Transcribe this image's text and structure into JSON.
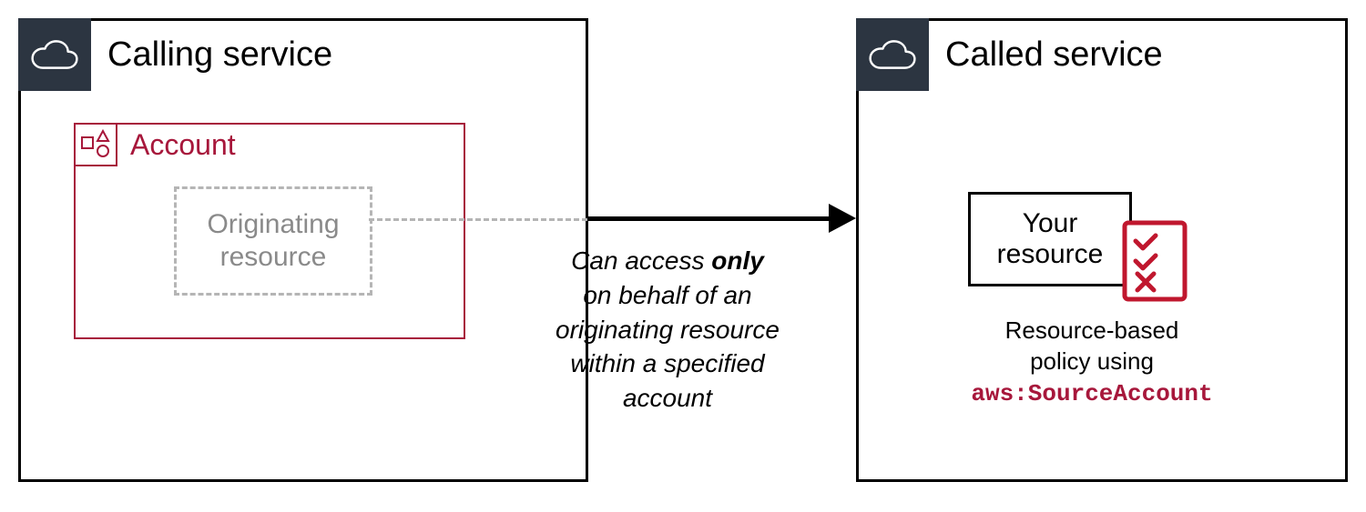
{
  "calling_service": {
    "title": "Calling service",
    "account": {
      "title": "Account",
      "originating_resource_label": "Originating\nresource"
    }
  },
  "arrow_caption": {
    "prefix": "Can access ",
    "bold": "only",
    "rest": "\non behalf of an\noriginating resource\nwithin a specified\naccount"
  },
  "called_service": {
    "title": "Called service",
    "your_resource_label": "Your\nresource",
    "policy_text": {
      "line1": "Resource-based",
      "line2": "policy using",
      "key": "aws:SourceAccount"
    }
  }
}
